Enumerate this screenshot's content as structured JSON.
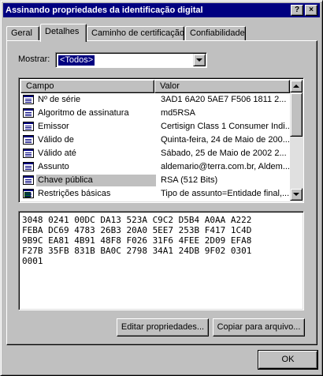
{
  "window": {
    "title": "Assinando propriedades da identificação digital",
    "help_label": "?",
    "close_label": "×"
  },
  "tabs": [
    {
      "label": "Geral"
    },
    {
      "label": "Detalhes"
    },
    {
      "label": "Caminho de certificação"
    },
    {
      "label": "Confiabilidade"
    }
  ],
  "show": {
    "label": "Mostrar:",
    "selected": "<Todos>"
  },
  "list": {
    "columns": [
      "Campo",
      "Valor"
    ],
    "rows": [
      {
        "field": "Nº de série",
        "value": "3AD1 6A20 5AE7 F506 1811 2...",
        "icon": "field-icon"
      },
      {
        "field": "Algoritmo de assinatura",
        "value": "md5RSA",
        "icon": "field-icon"
      },
      {
        "field": "Emissor",
        "value": "Certisign Class 1 Consumer Indi...",
        "icon": "field-icon"
      },
      {
        "field": "Válido de",
        "value": "Quinta-feira, 24 de Maio de 200...",
        "icon": "field-icon"
      },
      {
        "field": "Válido até",
        "value": "Sábado, 25 de Maio de 2002 2...",
        "icon": "field-icon"
      },
      {
        "field": "Assunto",
        "value": "aldemario@terra.com.br, Aldem...",
        "icon": "field-icon"
      },
      {
        "field": "Chave pública",
        "value": "RSA (512 Bits)",
        "icon": "field-icon"
      },
      {
        "field": "Restrições básicas",
        "value": "Tipo de assunto=Entidade final,...",
        "icon": "extension-icon"
      }
    ]
  },
  "details": {
    "lines": [
      "3048 0241 00DC DA13 523A C9C2 D5B4 A0AA A222",
      "FEBA DC69 4783 26B3 20A0 5EE7 253B F417 1C4D",
      "9B9C EA81 4B91 48F8 F026 31F6 4FEE 2D09 EFA8",
      "F27B 35FB 831B BA0C 2798 34A1 24DB 9F02 0301",
      "0001"
    ]
  },
  "buttons": {
    "edit": "Editar propriedades...",
    "copy": "Copiar para arquivo...",
    "ok": "OK"
  },
  "colors": {
    "titlebar": "#000080",
    "selection": "#000080",
    "face": "#c0c0c0"
  }
}
